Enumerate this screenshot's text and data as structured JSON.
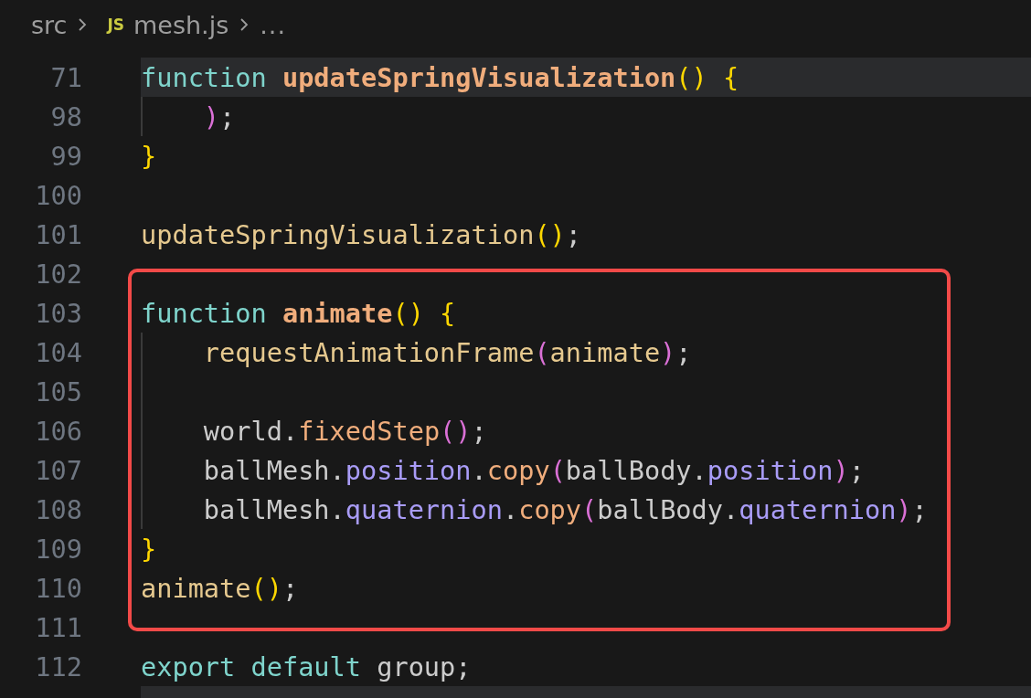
{
  "breadcrumb": [
    {
      "kind": "folder",
      "text": "src"
    },
    {
      "kind": "file",
      "icon": "JS",
      "text": "mesh.js"
    },
    {
      "kind": "more",
      "text": "..."
    }
  ],
  "blocks": [
    {
      "kind": "plain",
      "lines": [
        {
          "number": "71",
          "line_highlight": true,
          "indent_guide": false,
          "tokens": [
            {
              "kind": "kw",
              "text": "function"
            },
            {
              "kind": "fn",
              "text": "updateSpringVisualization"
            },
            {
              "kind": "brk1",
              "text": "()"
            },
            {
              "kind": "brk1",
              "text": "{"
            }
          ]
        },
        {
          "number": "98",
          "line_highlight": false,
          "indent_guide": true,
          "tokens": [
            {
              "kind": "brk2",
              "text": ")"
            },
            {
              "kind": "plain",
              "text": ";"
            }
          ]
        },
        {
          "number": "99",
          "line_highlight": false,
          "indent_guide": false,
          "tokens": [
            {
              "kind": "brk1",
              "text": "}"
            }
          ]
        },
        {
          "number": "100",
          "line_highlight": false,
          "indent_guide": false
        },
        {
          "number": "101",
          "line_highlight": false,
          "indent_guide": false,
          "tokens": [
            {
              "kind": "call",
              "text": "updateSpringVisualization"
            },
            {
              "kind": "brk1",
              "text": "()"
            },
            {
              "kind": "plain",
              "text": ";"
            }
          ]
        },
        {
          "number": "102",
          "line_highlight": false,
          "indent_guide": false
        }
      ]
    },
    {
      "kind": "boxed",
      "lines": [
        {
          "number": "103",
          "line_highlight": false,
          "indent_guide": false,
          "tokens": [
            {
              "kind": "kw",
              "text": "function"
            },
            {
              "kind": "fn",
              "text": "animate"
            },
            {
              "kind": "brk1",
              "text": "()"
            },
            {
              "kind": "brk1",
              "text": "{"
            }
          ]
        },
        {
          "number": "104",
          "line_highlight": false,
          "indent_guide": true,
          "tokens": [
            {
              "kind": "call",
              "text": "requestAnimationFrame"
            },
            {
              "kind": "brk2",
              "text": "("
            },
            {
              "kind": "call",
              "text": "animate"
            },
            {
              "kind": "brk2",
              "text": ")"
            },
            {
              "kind": "plain",
              "text": ";"
            }
          ]
        },
        {
          "number": "105",
          "line_highlight": false,
          "indent_guide": true
        },
        {
          "number": "106",
          "line_highlight": false,
          "indent_guide": true,
          "tokens": [
            {
              "kind": "plain",
              "text": "world."
            },
            {
              "kind": "method",
              "text": "fixedStep"
            },
            {
              "kind": "brk2",
              "text": "()"
            },
            {
              "kind": "plain",
              "text": ";"
            }
          ]
        },
        {
          "number": "107",
          "line_highlight": false,
          "indent_guide": true,
          "tokens": [
            {
              "kind": "plain",
              "text": "ballMesh."
            },
            {
              "kind": "prop",
              "text": "position"
            },
            {
              "kind": "plain",
              "text": "."
            },
            {
              "kind": "method",
              "text": "copy"
            },
            {
              "kind": "brk2",
              "text": "("
            },
            {
              "kind": "plain",
              "text": "ballBody."
            },
            {
              "kind": "prop",
              "text": "position"
            },
            {
              "kind": "brk2",
              "text": ")"
            },
            {
              "kind": "plain",
              "text": ";"
            }
          ]
        },
        {
          "number": "108",
          "line_highlight": false,
          "indent_guide": true,
          "tokens": [
            {
              "kind": "plain",
              "text": "ballMesh."
            },
            {
              "kind": "prop",
              "text": "quaternion"
            },
            {
              "kind": "plain",
              "text": "."
            },
            {
              "kind": "method",
              "text": "copy"
            },
            {
              "kind": "brk2",
              "text": "("
            },
            {
              "kind": "plain",
              "text": "ballBody."
            },
            {
              "kind": "prop",
              "text": "quaternion"
            },
            {
              "kind": "brk2",
              "text": ")"
            },
            {
              "kind": "plain",
              "text": ";"
            }
          ]
        },
        {
          "number": "109",
          "line_highlight": false,
          "indent_guide": false,
          "tokens": [
            {
              "kind": "brk1",
              "text": "}"
            }
          ]
        },
        {
          "number": "110",
          "line_highlight": false,
          "indent_guide": false,
          "tokens": [
            {
              "kind": "call",
              "text": "animate"
            },
            {
              "kind": "brk1",
              "text": "()"
            },
            {
              "kind": "plain",
              "text": ";"
            }
          ]
        }
      ]
    },
    {
      "kind": "plain",
      "lines": [
        {
          "number": "111",
          "line_highlight": false,
          "indent_guide": false
        },
        {
          "number": "112",
          "line_highlight": false,
          "indent_guide": false,
          "tokens": [
            {
              "kind": "kw",
              "text": "export"
            },
            {
              "kind": "kw",
              "text": "default"
            },
            {
              "kind": "plain",
              "text": "group;"
            }
          ]
        },
        {
          "line_highlight": true,
          "indent_guide": false
        }
      ]
    }
  ]
}
